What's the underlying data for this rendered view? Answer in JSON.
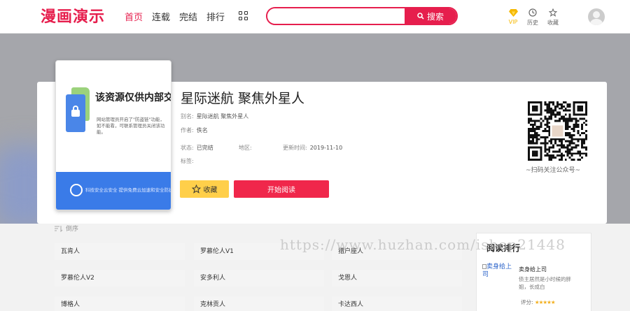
{
  "header": {
    "logo": "漫画演示",
    "nav": [
      "首页",
      "连载",
      "完结",
      "排行"
    ],
    "search": {
      "placeholder": "",
      "button_label": "搜索"
    },
    "icons": [
      {
        "label": "VIP",
        "icon": "diamond-icon",
        "color": "#f5b800"
      },
      {
        "label": "历史",
        "icon": "clock-icon"
      },
      {
        "label": "收藏",
        "icon": "star-icon"
      }
    ]
  },
  "cover": {
    "title": "该资源仅供内部交流!",
    "desc": "网站管理员开启了\"防盗链\"功能，如不能看，可联系管理员关闭该功能。",
    "footer": "科技安全云安全  提供免费云加速和安全防护服务"
  },
  "comic": {
    "title": "星际迷航 聚焦外星人",
    "alias_label": "别名:",
    "alias": "星际迷航 聚焦外星人",
    "author_label": "作者:",
    "author": "佚名",
    "status_label": "状态:",
    "status": "已完结",
    "region_label": "地区:",
    "region": "",
    "updated_label": "更新时间:",
    "updated": "2019-11-10",
    "tags_label": "标签:",
    "tags": ""
  },
  "actions": {
    "favorite": "收藏",
    "read": "开始阅读"
  },
  "qr": {
    "caption": "~扫码关注公众号~"
  },
  "chapters": {
    "sort_label": "倒序",
    "items": [
      "瓦肯人",
      "罗慕伦人V1",
      "猎户座人",
      "罗慕伦人V2",
      "安多利人",
      "戈恩人",
      "博格人",
      "克林贡人",
      "卡达西人"
    ]
  },
  "ranking": {
    "title": "阅读排行",
    "item": {
      "image_alt": "卖身给上司",
      "name": "卖身给上司",
      "desc": "债主居然是小时候的胖姐，长成白",
      "score_label": "评分:",
      "rating": 5
    }
  },
  "watermark": "https://www.huzhan.com/ishop21448"
}
